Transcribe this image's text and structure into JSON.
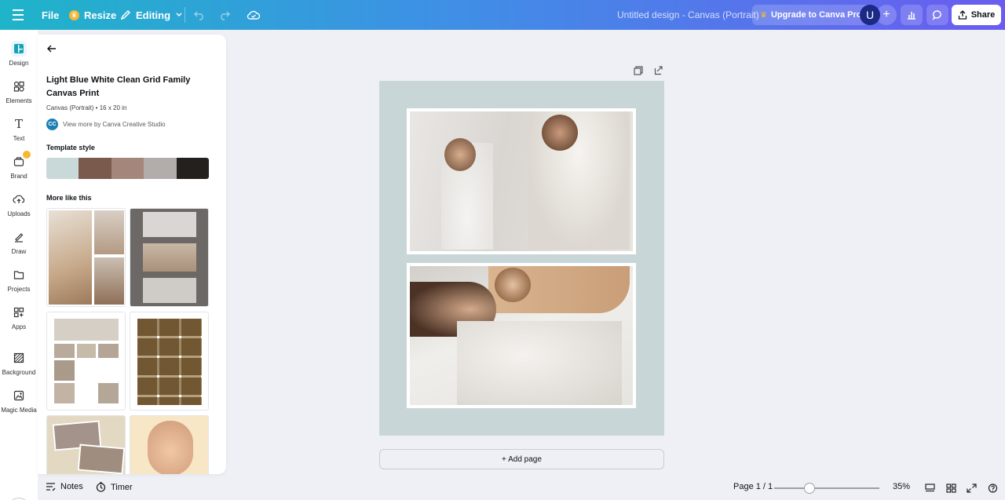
{
  "topbar": {
    "file_label": "File",
    "resize_label": "Resize",
    "editing_label": "Editing",
    "design_title": "Untitled design - Canvas (Portrait)",
    "upgrade_label": "Upgrade to Canva Pro",
    "avatar_initial": "U",
    "share_label": "Share"
  },
  "rail": {
    "items": [
      {
        "label": "Design",
        "icon": "design-icon"
      },
      {
        "label": "Elements",
        "icon": "elements-icon"
      },
      {
        "label": "Text",
        "icon": "text-icon"
      },
      {
        "label": "Brand",
        "icon": "brand-icon"
      },
      {
        "label": "Uploads",
        "icon": "uploads-icon"
      },
      {
        "label": "Draw",
        "icon": "draw-icon"
      },
      {
        "label": "Projects",
        "icon": "projects-icon"
      },
      {
        "label": "Apps",
        "icon": "apps-icon"
      },
      {
        "label": "Background",
        "icon": "background-icon"
      },
      {
        "label": "Magic Media",
        "icon": "magic-media-icon"
      }
    ]
  },
  "panel": {
    "title": "Light Blue White Clean Grid Family Canvas Print",
    "meta": "Canvas (Portrait) • 16 x 20 in",
    "creator_badge": "CC",
    "creator_link": "View more by Canva Creative Studio",
    "template_style_heading": "Template style",
    "swatches": [
      "#c9d9d9",
      "#7a5a4c",
      "#a4877a",
      "#b2acab",
      "#24201d"
    ],
    "more_heading": "More like this"
  },
  "canvas": {
    "add_page_label": "+ Add page"
  },
  "bottombar": {
    "notes_label": "Notes",
    "timer_label": "Timer",
    "page_indicator": "Page 1 / 1",
    "zoom_label": "35%"
  },
  "colors": {
    "accent": "#6a5cf0",
    "page_bg": "#c8d6d8"
  }
}
